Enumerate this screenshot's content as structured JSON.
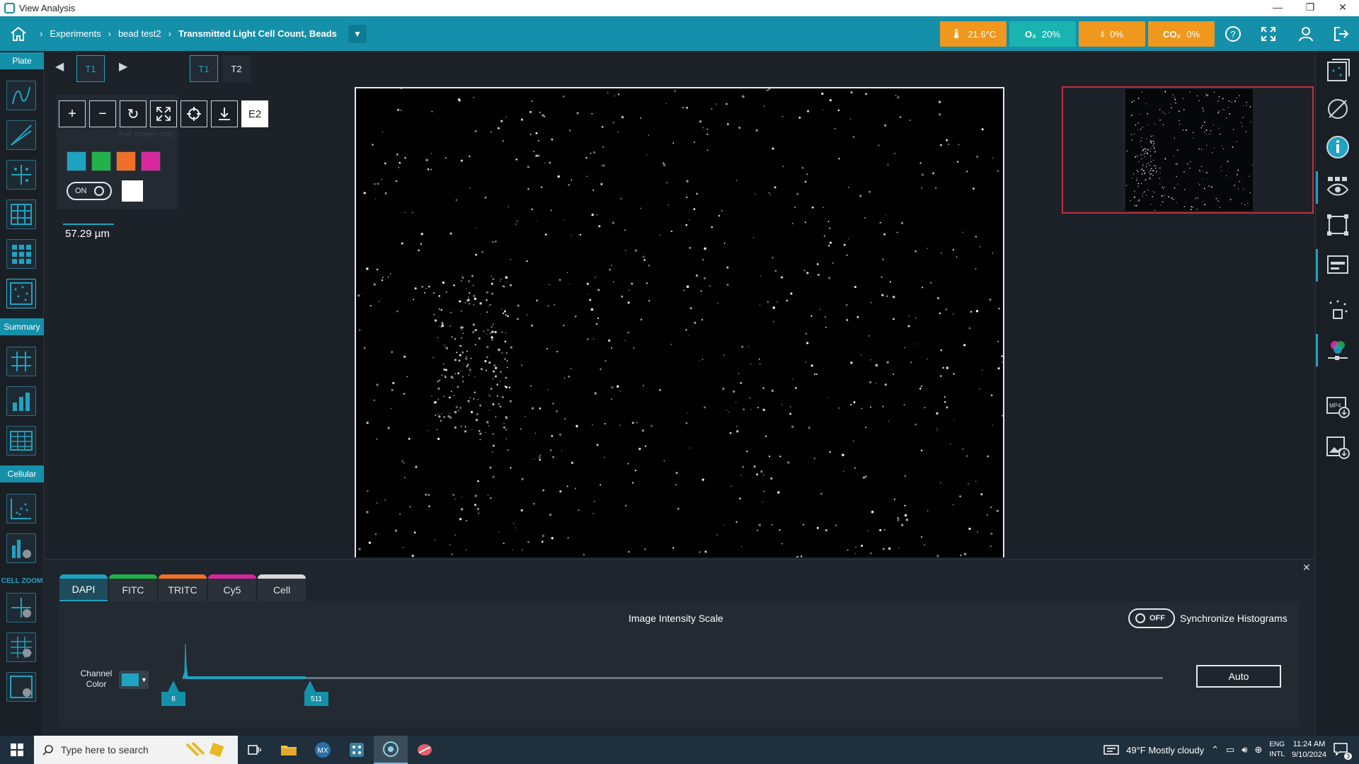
{
  "window": {
    "title": "View Analysis",
    "controls": [
      "—",
      "❐",
      "✕"
    ]
  },
  "breadcrumb": {
    "items": [
      "Experiments",
      "bead test2",
      "Transmitted Light Cell Count, Beads"
    ]
  },
  "environment": {
    "temperature": {
      "value": "21.6°C",
      "color": "#f0971e"
    },
    "o2": {
      "value": "20%",
      "color": "#19b3b0"
    },
    "humidity": {
      "value": "0%",
      "color": "#f0971e"
    },
    "co2": {
      "value": "0%",
      "color": "#f0971e"
    },
    "o2_glyph": "O₂",
    "co2_glyph": "CO₂"
  },
  "left_sidebar": {
    "sections": [
      "Plate",
      "Summary",
      "Cellular",
      "CELL ZOOM"
    ]
  },
  "timepoints": {
    "current": "T1",
    "tabs": [
      "T1",
      "T2"
    ]
  },
  "tools": {
    "well_label": "E2",
    "tooltip": "Full screen only",
    "overlay_toggle": "ON",
    "swatches": [
      "#1ea3c1",
      "#21b24a",
      "#f0702a",
      "#d6279e"
    ]
  },
  "scale_bar": {
    "value": "57.29",
    "unit": "µm"
  },
  "histogram": {
    "channels": [
      {
        "label": "DAPI",
        "color": "#1ea3c1",
        "active": true
      },
      {
        "label": "FITC",
        "color": "#21b24a",
        "active": false
      },
      {
        "label": "TRITC",
        "color": "#f0702a",
        "active": false
      },
      {
        "label": "Cy5",
        "color": "#d6279e",
        "active": false
      },
      {
        "label": "Cell",
        "color": "#d8d8d8",
        "active": false
      }
    ],
    "title": "Image Intensity Scale",
    "sync_toggle": "OFF",
    "sync_label": "Synchronize Histograms",
    "channel_color_label": "Channel Color",
    "min_handle": "8",
    "max_handle": "511",
    "auto_button": "Auto",
    "close_glyph": "✕"
  },
  "taskbar": {
    "search_placeholder": "Type here to search",
    "weather": "49°F  Mostly cloudy",
    "lang_line1": "ENG",
    "lang_line2": "INTL",
    "time": "11:24 AM",
    "date": "9/10/2024",
    "notif_count": "3"
  }
}
